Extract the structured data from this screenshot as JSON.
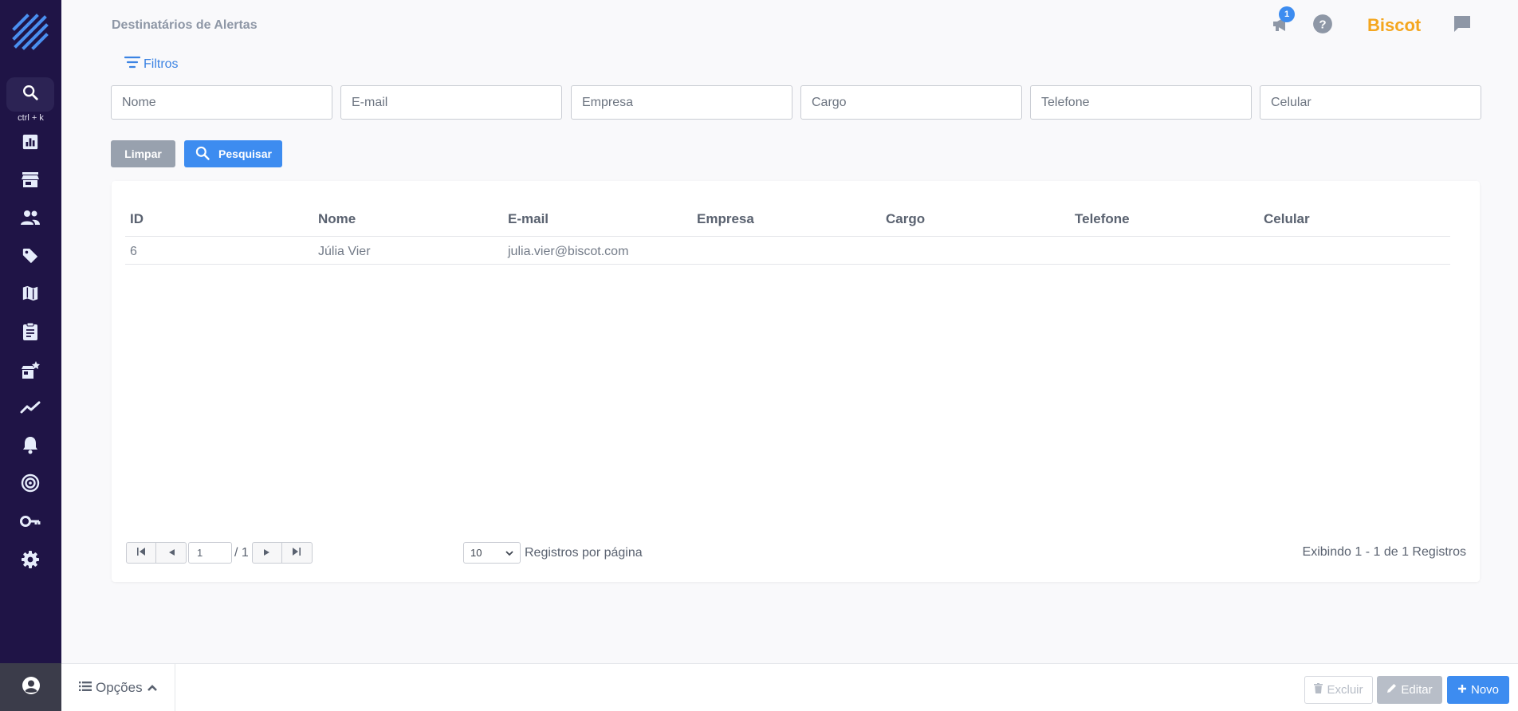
{
  "page": {
    "title": "Destinatários de Alertas"
  },
  "header": {
    "notification_count": "1",
    "brand": "Biscot",
    "icons": [
      "megaphone-icon",
      "help-icon",
      "chat-icon"
    ]
  },
  "sidebar": {
    "shortcut_hint": "ctrl + k",
    "items": [
      {
        "name": "search-icon"
      },
      {
        "name": "dashboard-icon"
      },
      {
        "name": "store-icon"
      },
      {
        "name": "people-icon"
      },
      {
        "name": "tag-icon"
      },
      {
        "name": "map-icon"
      },
      {
        "name": "clipboard-icon"
      },
      {
        "name": "store-star-icon"
      },
      {
        "name": "trend-icon"
      },
      {
        "name": "bell-icon"
      },
      {
        "name": "target-icon"
      },
      {
        "name": "key-icon"
      },
      {
        "name": "gear-icon"
      }
    ],
    "bottom_icon": "user-icon"
  },
  "filters": {
    "toggle_label": "Filtros",
    "fields": [
      {
        "placeholder": "Nome",
        "value": ""
      },
      {
        "placeholder": "E-mail",
        "value": ""
      },
      {
        "placeholder": "Empresa",
        "value": ""
      },
      {
        "placeholder": "Cargo",
        "value": ""
      },
      {
        "placeholder": "Telefone",
        "value": ""
      },
      {
        "placeholder": "Celular",
        "value": ""
      }
    ],
    "clear_label": "Limpar",
    "search_label": "Pesquisar"
  },
  "table": {
    "columns": [
      "ID",
      "Nome",
      "E-mail",
      "Empresa",
      "Cargo",
      "Telefone",
      "Celular"
    ],
    "rows": [
      [
        "6",
        "Júlia Vier",
        "julia.vier@biscot.com",
        "",
        "",
        "",
        ""
      ]
    ]
  },
  "pagination": {
    "current_page": "1",
    "total_pages": "/ 1",
    "per_page": "10",
    "per_page_label": "Registros por página",
    "summary": "Exibindo 1 - 1 de 1 Registros"
  },
  "footer": {
    "options_label": "Opções",
    "delete_label": "Excluir",
    "edit_label": "Editar",
    "new_label": "Novo"
  },
  "colors": {
    "sidebar_bg": "#1f1446",
    "accent": "#3d8cf0",
    "brand": "#f4a61f",
    "muted_button": "#98a1ae"
  }
}
